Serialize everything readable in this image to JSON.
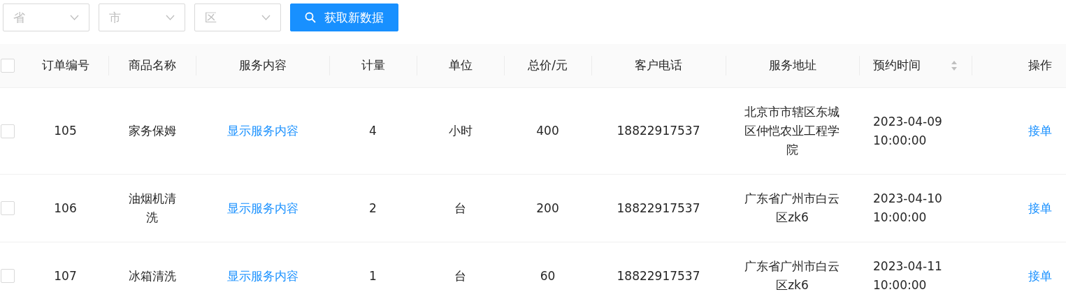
{
  "filters": [
    {
      "placeholder": "省"
    },
    {
      "placeholder": "市"
    },
    {
      "placeholder": "区"
    }
  ],
  "fetch_button": {
    "label": "获取新数据"
  },
  "table": {
    "select_all": {
      "checked": false
    },
    "columns": [
      {
        "label": "订单编号",
        "sortable": false
      },
      {
        "label": "商品名称",
        "sortable": false
      },
      {
        "label": "服务内容",
        "sortable": false
      },
      {
        "label": "计量",
        "sortable": false
      },
      {
        "label": "单位",
        "sortable": false
      },
      {
        "label": "总价/元",
        "sortable": false
      },
      {
        "label": "客户电话",
        "sortable": false
      },
      {
        "label": "服务地址",
        "sortable": false
      },
      {
        "label": "预约时间",
        "sortable": true
      },
      {
        "label": "操作",
        "sortable": false
      }
    ],
    "rows": [
      {
        "checked": false,
        "order_no": "105",
        "product": "家务保姆",
        "service": "显示服务内容",
        "quantity": "4",
        "unit": "小时",
        "total": "400",
        "phone": "18822917537",
        "address": "北京市市辖区东城区仲恺农业工程学院",
        "time": "2023-04-09 10:00:00",
        "action": "接单"
      },
      {
        "checked": false,
        "order_no": "106",
        "product": "油烟机清洗",
        "service": "显示服务内容",
        "quantity": "2",
        "unit": "台",
        "total": "200",
        "phone": "18822917537",
        "address": "广东省广州市白云区zk6",
        "time": "2023-04-10 10:00:00",
        "action": "接单"
      },
      {
        "checked": false,
        "order_no": "107",
        "product": "冰箱清洗",
        "service": "显示服务内容",
        "quantity": "1",
        "unit": "台",
        "total": "60",
        "phone": "18822917537",
        "address": "广东省广州市白云区zk6",
        "time": "2023-04-11 10:00:00",
        "action": "接单"
      }
    ]
  }
}
